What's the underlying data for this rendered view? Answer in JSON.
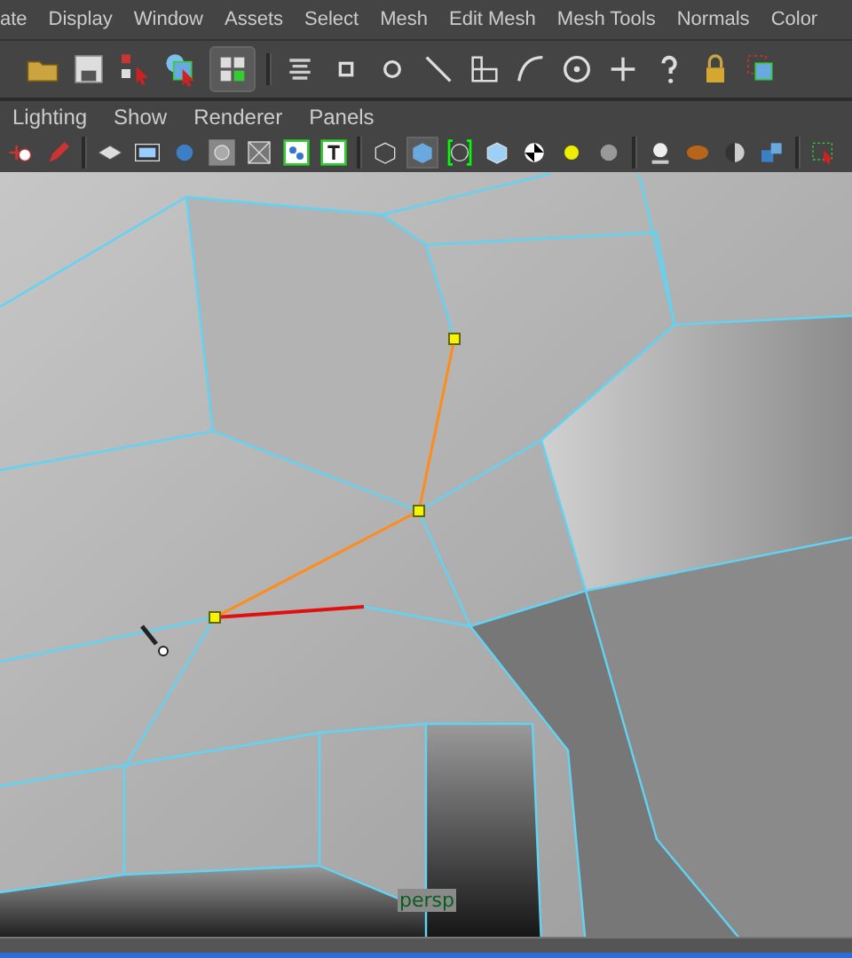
{
  "menu_bar": {
    "items": [
      "ate",
      "Display",
      "Window",
      "Assets",
      "Select",
      "Mesh",
      "Edit Mesh",
      "Mesh Tools",
      "Normals",
      "Color"
    ]
  },
  "panel_menu": {
    "items": [
      "Lighting",
      "Show",
      "Renderer",
      "Panels"
    ]
  },
  "viewport": {
    "camera_label": "persp"
  }
}
